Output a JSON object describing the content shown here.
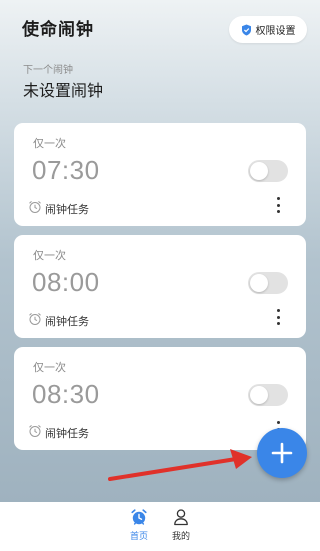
{
  "header": {
    "title": "使命闹钟",
    "permission_button": "权限设置"
  },
  "next_alarm": {
    "label": "下一个闹钟",
    "value": "未设置闹钟"
  },
  "alarms": [
    {
      "frequency": "仅一次",
      "time": "07:30",
      "task_label": "闹钟任务",
      "enabled": false
    },
    {
      "frequency": "仅一次",
      "time": "08:00",
      "task_label": "闹钟任务",
      "enabled": false
    },
    {
      "frequency": "仅一次",
      "time": "08:30",
      "task_label": "闹钟任务",
      "enabled": false
    }
  ],
  "fab": {
    "icon": "plus-icon"
  },
  "annotation": {
    "arrow_color": "#e0312a"
  },
  "tabbar": {
    "home_label": "首页",
    "mine_label": "我的",
    "active_color": "#3a86e8"
  }
}
